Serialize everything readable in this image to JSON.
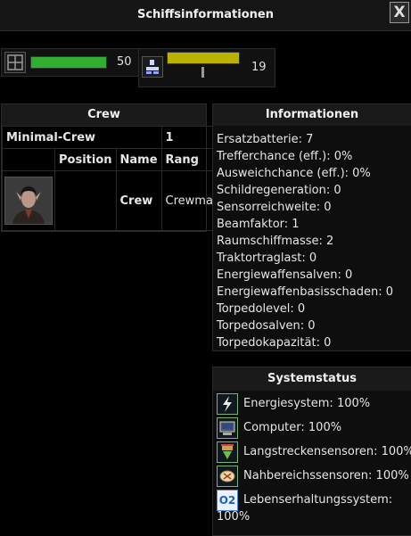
{
  "window": {
    "title": "Schiffsinformationen",
    "close_label": "X"
  },
  "bars": [
    {
      "value": "50",
      "fill": 1.0,
      "color": "#2fae2f",
      "icon": "hull-grid-icon"
    },
    {
      "value": "19",
      "fill": 1.0,
      "color": "#b9b300",
      "icon": "crew-transfer-icon"
    }
  ],
  "crew": {
    "header": "Crew",
    "minimal_label": "Minimal-Crew",
    "minimal_value": "1",
    "columns": [
      "Position",
      "Name",
      "Rang"
    ],
    "member": {
      "name": "Crew",
      "rank": "Crewman"
    }
  },
  "info": {
    "header": "Informationen",
    "items": [
      "Ersatzbatterie: 7",
      "Trefferchance (eff.): 0%",
      "Ausweichchance (eff.): 0%",
      "Schildregeneration: 0",
      "Sensorreichweite: 0",
      "Beamfaktor: 1",
      "Raumschiffmasse: 2",
      "Traktortraglast: 0",
      "Energiewaffensalven: 0",
      "Energiewaffenbasisschaden: 0",
      "Torpedolevel: 0",
      "Torpedosalven: 0",
      "Torpedokapazität: 0"
    ]
  },
  "system": {
    "header": "Systemstatus",
    "items": [
      {
        "label": "Energiesystem: 100%",
        "icon": "lightning-icon"
      },
      {
        "label": "Computer: 100%",
        "icon": "computer-icon"
      },
      {
        "label": "Langstreckensensoren: 100%",
        "icon": "long-range-sensor-icon"
      },
      {
        "label": "Nahbereichssensoren: 100%",
        "icon": "short-range-sensor-icon"
      },
      {
        "label": "Lebenserhaltungssystem:",
        "label2": "100%",
        "icon": "oxygen-icon",
        "icon_text": "O2"
      }
    ]
  }
}
